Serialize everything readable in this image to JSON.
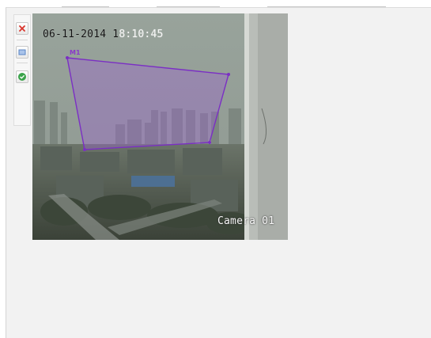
{
  "video": {
    "date_text": "06-11-2014 1",
    "time_text": "8:10:45",
    "camera_label": "Camera 01",
    "roi_label": "M1"
  },
  "toolbar": {
    "tools": [
      {
        "name": "delete",
        "icon": "close-icon",
        "color": "#d9342b"
      },
      {
        "name": "draw-area",
        "icon": "rectangle-icon",
        "color": "#5b86c6"
      },
      {
        "name": "confirm",
        "icon": "check-icon",
        "color": "#3aa34a"
      }
    ]
  },
  "colors": {
    "roi_stroke": "#7b2fc4",
    "roi_fill": "#9b62cf"
  }
}
